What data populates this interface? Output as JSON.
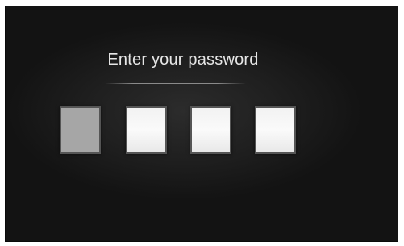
{
  "prompt": {
    "text": "Enter your password"
  },
  "pin_entry": {
    "digit_count": 4,
    "active_index": 0,
    "colors": {
      "active_fill": "#a6a6a6",
      "idle_fill": "#f5f5f5",
      "background": "#1f1f1f",
      "text": "#e6e6e6"
    }
  }
}
